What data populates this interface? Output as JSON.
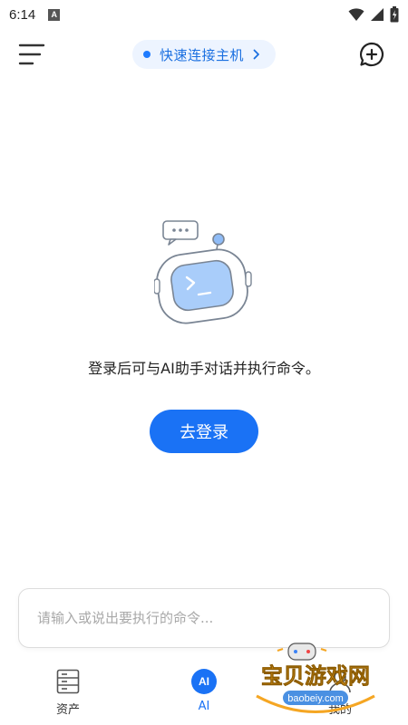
{
  "status_bar": {
    "time": "6:14",
    "app_icon_letter": "A",
    "icons": [
      "wifi-icon",
      "signal-icon",
      "battery-icon"
    ]
  },
  "header": {
    "menu_icon": "menu-icon",
    "quick_connect_label": "快速连接主机",
    "quick_connect_status_color": "#1e7bff",
    "new_chat_icon": "add-chat-icon"
  },
  "empty_state": {
    "illustration": "robot-icon",
    "message": "登录后可与AI助手对话并执行命令。",
    "login_button": "去登录"
  },
  "input": {
    "placeholder": "请输入或说出要执行的命令..."
  },
  "bottom_nav": {
    "items": [
      {
        "label": "资产",
        "icon": "server-icon",
        "active": false
      },
      {
        "label": "AI",
        "icon": "ai-icon",
        "badge": "AI",
        "active": true
      },
      {
        "label": "我的",
        "icon": "profile-icon",
        "active": false
      }
    ]
  },
  "watermark": {
    "title": "宝贝游戏网",
    "url": "baobeiy.com"
  },
  "colors": {
    "accent": "#1a72f5",
    "chip_bg": "#edf4ff"
  }
}
